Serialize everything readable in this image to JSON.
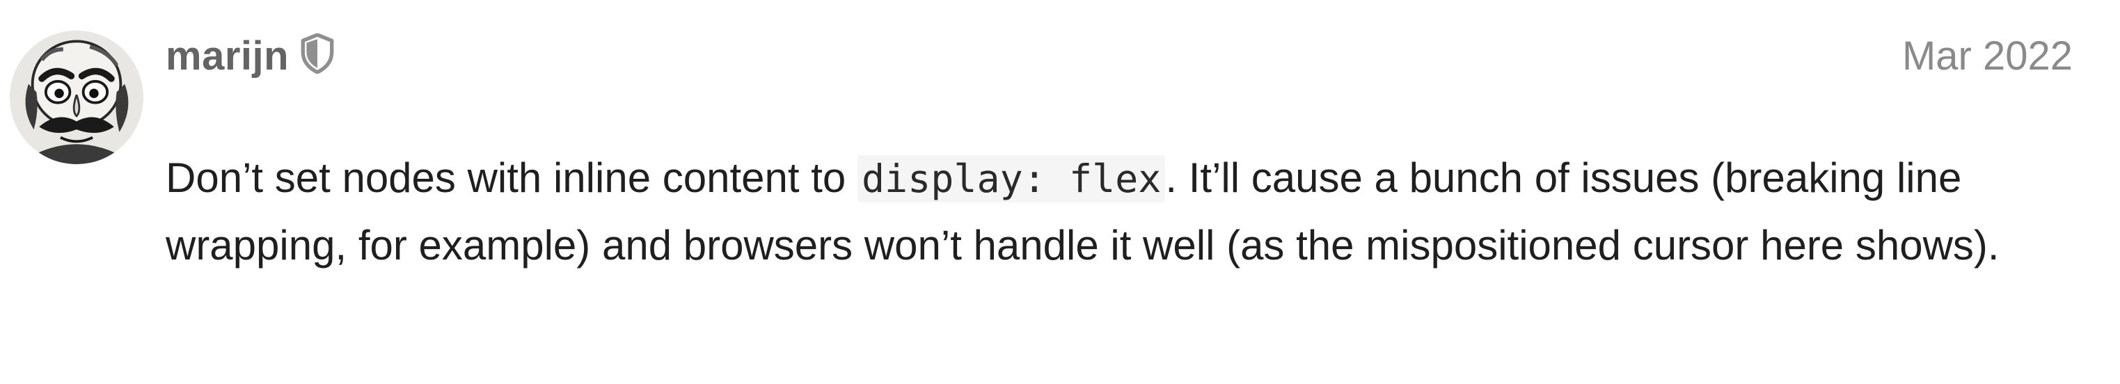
{
  "post": {
    "author": {
      "username": "marijn",
      "avatar_icon": "caricature-avatar",
      "badge_icon": "shield-icon"
    },
    "date": "Mar 2022",
    "body": {
      "text_before_code": "Don’t set nodes with inline content to ",
      "code": "display: flex",
      "text_after_code": ". It’ll cause a bunch of issues (breaking line wrapping, for example) and browsers won’t handle it well (as the mispositioned cursor here shows)."
    }
  },
  "colors": {
    "username": "#646464",
    "date": "#8a8a8a",
    "body_text": "#1f1f1f",
    "code_background": "#f5f5f5",
    "badge": "#8f8f8f"
  }
}
